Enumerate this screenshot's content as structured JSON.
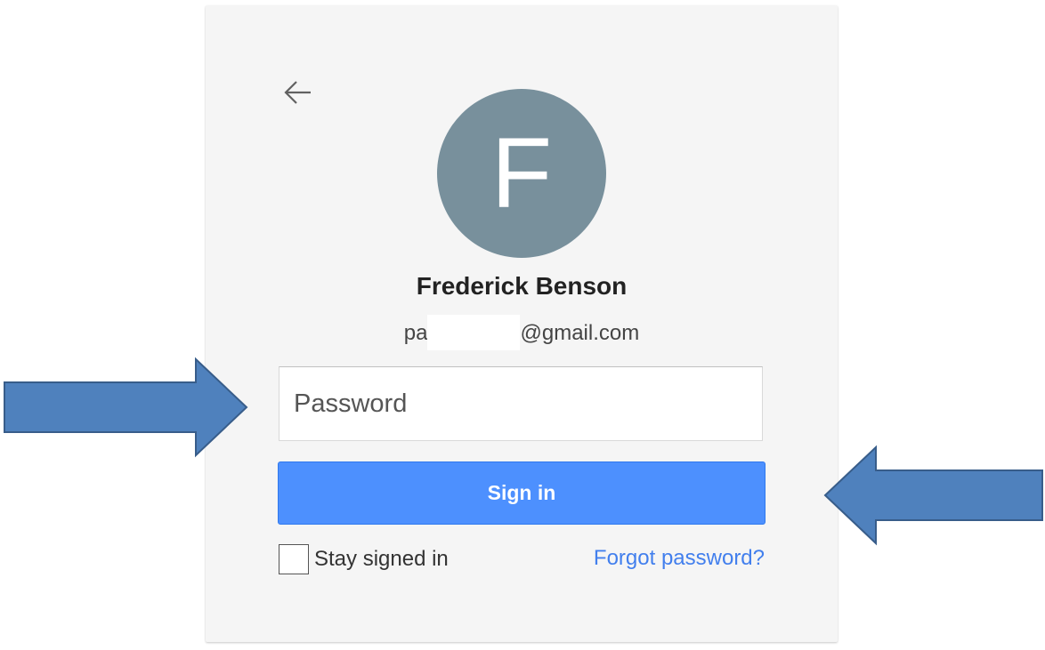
{
  "account": {
    "avatar_letter": "F",
    "name": "Frederick Benson",
    "email_prefix": "pa",
    "email_suffix": "@gmail.com"
  },
  "login_form": {
    "password_placeholder": "Password",
    "signin_label": "Sign in",
    "stay_signed_in_label": "Stay signed in",
    "forgot_password_label": "Forgot password?"
  },
  "icons": {
    "back": "back-arrow-icon"
  },
  "colors": {
    "card_background": "#f5f5f5",
    "avatar_background": "#78909c",
    "signin_button": "#4d90fe",
    "link": "#427fed",
    "callout_fill": "#4f81bd",
    "callout_stroke": "#385d8a"
  }
}
